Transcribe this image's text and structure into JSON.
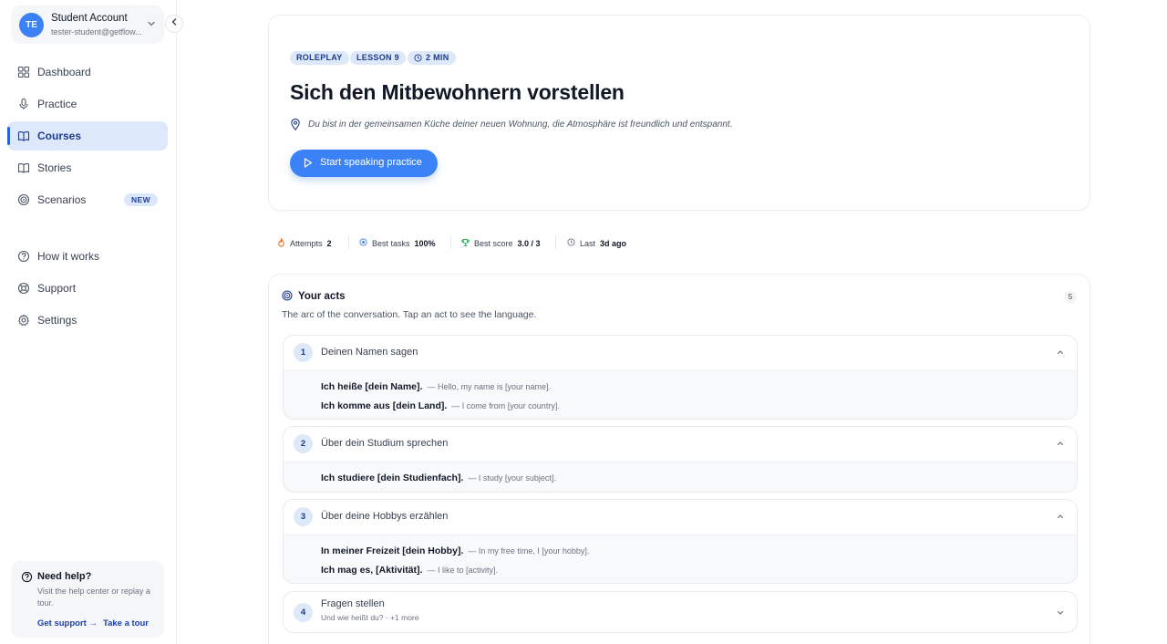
{
  "account": {
    "initials": "TE",
    "name": "Student Account",
    "email": "tester-student@getflow..."
  },
  "nav": {
    "items": [
      {
        "label": "Dashboard"
      },
      {
        "label": "Practice"
      },
      {
        "label": "Courses"
      },
      {
        "label": "Stories"
      },
      {
        "label": "Scenarios",
        "badge": "NEW"
      }
    ],
    "secondary": [
      {
        "label": "How it works"
      },
      {
        "label": "Support"
      },
      {
        "label": "Settings"
      }
    ]
  },
  "help": {
    "title": "Need help?",
    "text": "Visit the help center or replay a tour.",
    "get_support": "Get support",
    "take_tour": "Take a tour"
  },
  "hero": {
    "chips": [
      "ROLEPLAY",
      "LESSON 9",
      "2 MIN"
    ],
    "title": "Sich den Mitbewohnern vorstellen",
    "description": "Du bist in der gemeinsamen Küche deiner neuen Wohnung, die Atmosphäre ist freundlich und entspannt.",
    "start_label": "Start speaking practice"
  },
  "stats": [
    {
      "label": "Attempts",
      "value": "2"
    },
    {
      "label": "Best tasks",
      "value": "100%"
    },
    {
      "label": "Best score",
      "value": "3.0 / 3"
    },
    {
      "label": "Last",
      "value": "3d ago"
    }
  ],
  "acts": {
    "title": "Your acts",
    "subtitle": "The arc of the conversation. Tap an act to see the language.",
    "count": "5",
    "list": [
      {
        "num": "1",
        "title": "Deinen Namen sagen",
        "lines": [
          {
            "de": "Ich heiße [dein Name].",
            "en": "— Hello, my name is [your name]."
          },
          {
            "de": "Ich komme aus [dein Land].",
            "en": "— I come from [your country]."
          }
        ]
      },
      {
        "num": "2",
        "title": "Über dein Studium sprechen",
        "lines": [
          {
            "de": "Ich studiere [dein Studienfach].",
            "en": "— I study [your subject]."
          }
        ]
      },
      {
        "num": "3",
        "title": "Über deine Hobbys erzählen",
        "lines": [
          {
            "de": "In meiner Freizeit [dein Hobby].",
            "en": "— In my free time, I [your hobby]."
          },
          {
            "de": "Ich mag es, [Aktivität].",
            "en": "— I like to [activity]."
          }
        ]
      },
      {
        "num": "4",
        "title": "Fragen stellen",
        "preview": "Und wie heißt du? · +1 more"
      }
    ]
  },
  "colors": {
    "accent": "#3b82f6",
    "accent_dark": "#1e3a8a",
    "chip_bg": "#dde8f8"
  }
}
